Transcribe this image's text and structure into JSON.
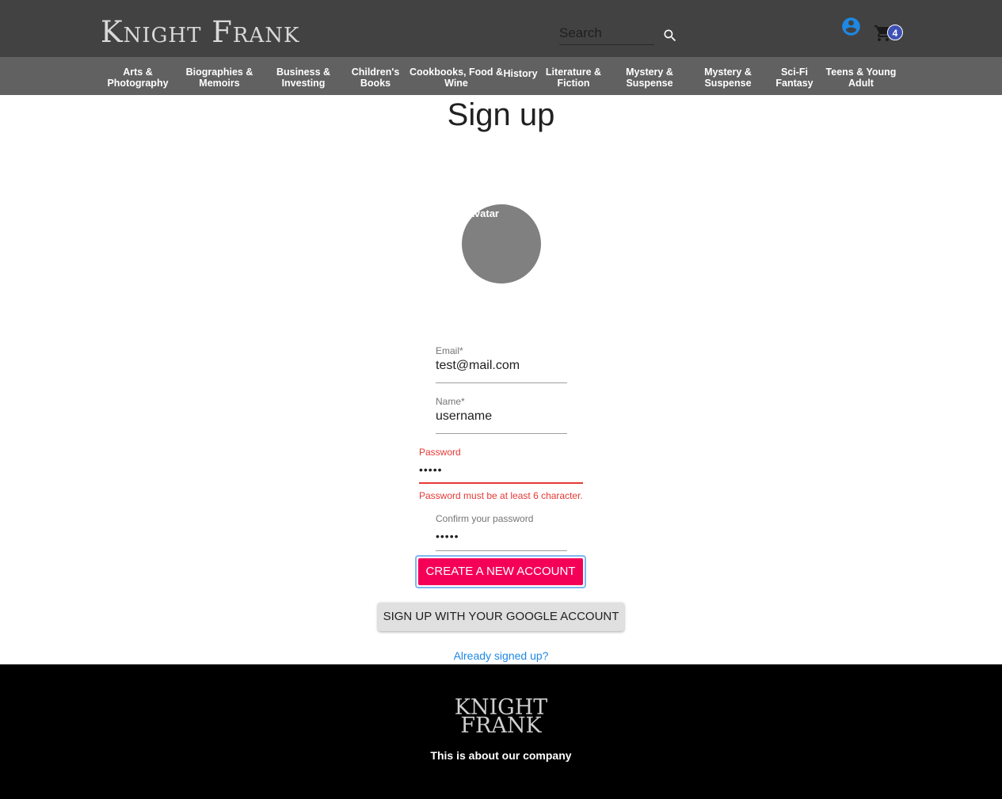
{
  "header": {
    "logo_text": "Knight Frank",
    "search_placeholder": "Search",
    "cart_count": "4"
  },
  "categories": [
    "Arts &\nPhotography",
    "Biographies &\nMemoirs",
    "Business &\nInvesting",
    "Children's\nBooks",
    "Cookbooks, Food &\nWine",
    "History",
    "Literature &\nFiction",
    "Mystery &\nSuspense",
    "Mystery &\nSuspense",
    "Sci-Fi\nFantasy",
    "Teens & Young\nAdult"
  ],
  "page": {
    "title": "Sign up",
    "avatar_label": "Avatar"
  },
  "form": {
    "email": {
      "label": "Email*",
      "value": "test@mail.com"
    },
    "name": {
      "label": "Name*",
      "value": "username"
    },
    "password": {
      "label": "Password",
      "value": "•••••",
      "error": "Password must be at least 6 character."
    },
    "confirm": {
      "label": "Confirm your password",
      "value": "•••••"
    },
    "create_button": "CREATE A NEW ACCOUNT",
    "google_button": "SIGN UP WITH YOUR GOOGLE ACCOUNT",
    "signed_link": "Already signed up?"
  },
  "footer": {
    "logo_line1": "KNIGHT",
    "logo_line2": "FRANK",
    "about": "This is about our company"
  },
  "colors": {
    "header_bg": "#424242",
    "category_bg": "#616161",
    "primary_button": "#f50057",
    "error": "#e53935",
    "link": "#1e88e5",
    "badge": "#3f51b5"
  }
}
